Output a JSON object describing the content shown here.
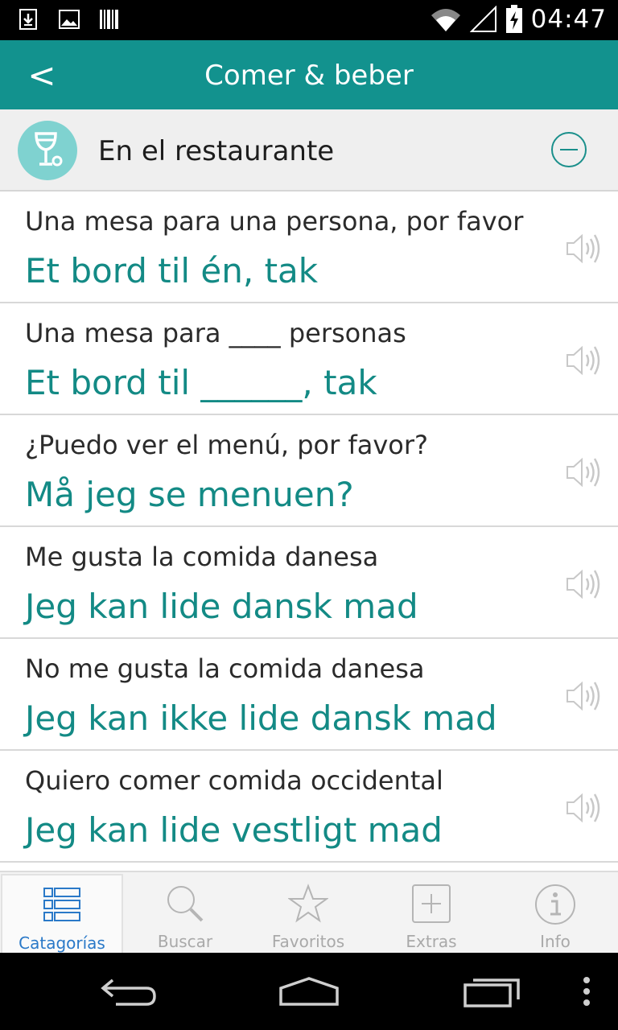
{
  "status_bar": {
    "time": "04:47",
    "icons": [
      "download-icon",
      "image-icon",
      "barcode-icon",
      "wifi-icon",
      "signal-icon",
      "battery-charging-icon"
    ]
  },
  "header": {
    "back_label": "<",
    "title": "Comer & beber"
  },
  "category": {
    "icon": "wine-glass-icon",
    "title": "En el restaurante",
    "collapse_icon": "minus-circle-icon"
  },
  "phrases": [
    {
      "source": "Una mesa para una persona, por favor",
      "translation": "Et bord til én, tak"
    },
    {
      "source": "Una mesa para ____ personas",
      "translation": "Et bord til ______, tak"
    },
    {
      "source": "¿Puedo ver el menú, por favor?",
      "translation": "Må jeg se menuen?"
    },
    {
      "source": "Me gusta la comida danesa",
      "translation": "Jeg kan lide dansk mad"
    },
    {
      "source": "No me gusta la comida danesa",
      "translation": "Jeg kan ikke lide dansk mad"
    },
    {
      "source": "Quiero comer comida occidental",
      "translation": "Jeg kan lide vestligt mad"
    }
  ],
  "tabs": [
    {
      "label": "Catagorías",
      "icon": "list-icon",
      "active": true
    },
    {
      "label": "Buscar",
      "icon": "search-icon",
      "active": false
    },
    {
      "label": "Favoritos",
      "icon": "star-icon",
      "active": false
    },
    {
      "label": "Extras",
      "icon": "plus-box-icon",
      "active": false
    },
    {
      "label": "Info",
      "icon": "info-icon",
      "active": false
    }
  ],
  "colors": {
    "header": "#12928e",
    "translation_text": "#138a85",
    "active_tab": "#2a79c8"
  }
}
